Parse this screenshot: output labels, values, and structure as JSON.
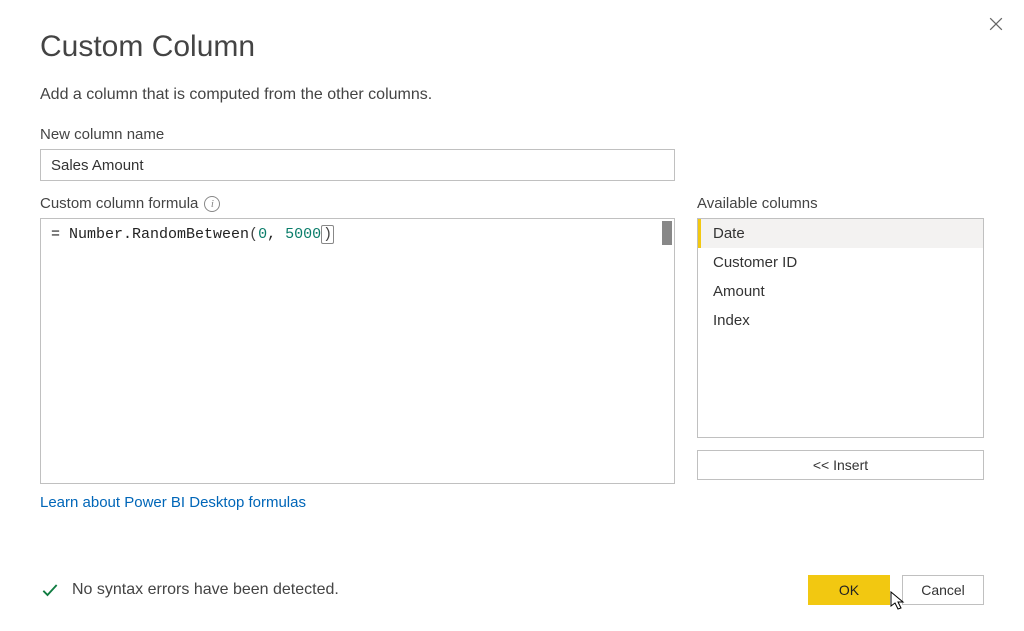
{
  "dialog": {
    "title": "Custom Column",
    "subtitle": "Add a column that is computed from the other columns."
  },
  "column_name": {
    "label": "New column name",
    "value": "Sales Amount"
  },
  "formula": {
    "label": "Custom column formula",
    "prefix": "= ",
    "func": "Number.RandomBetween",
    "open": "(",
    "arg1": "0",
    "comma": ", ",
    "arg2": "5000",
    "close": ")"
  },
  "available": {
    "label": "Available columns",
    "items": [
      "Date",
      "Customer ID",
      "Amount",
      "Index"
    ],
    "selected_index": 0,
    "insert_label": "<< Insert"
  },
  "learn_link": "Learn about Power BI Desktop formulas",
  "status": {
    "text": "No syntax errors have been detected."
  },
  "buttons": {
    "ok": "OK",
    "cancel": "Cancel"
  }
}
